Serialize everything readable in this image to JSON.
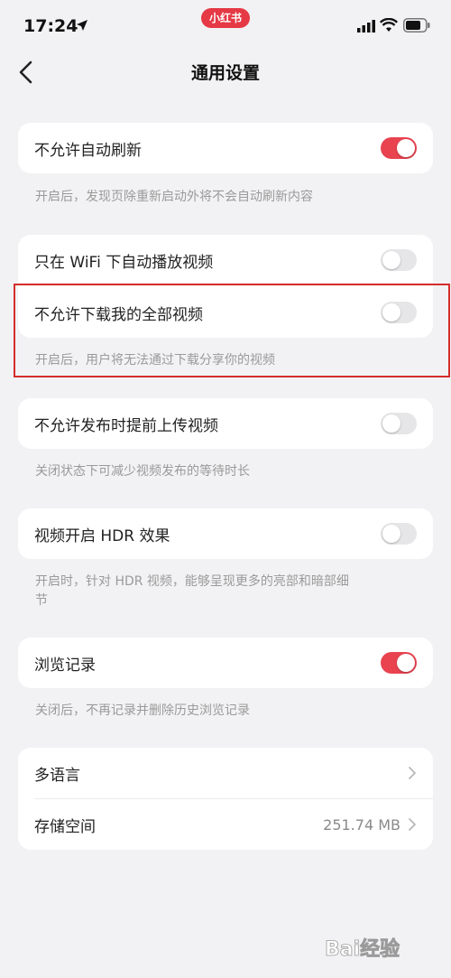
{
  "status_bar": {
    "time": "17:24",
    "app_badge": "小红书"
  },
  "nav": {
    "title": "通用设置"
  },
  "settings": {
    "auto_refresh": {
      "label": "不允许自动刷新",
      "enabled": true,
      "description": "开启后，发现页除重新启动外将不会自动刷新内容"
    },
    "wifi_autoplay": {
      "label": "只在 WiFi 下自动播放视频",
      "enabled": false
    },
    "no_download": {
      "label": "不允许下载我的全部视频",
      "enabled": false,
      "description": "开启后，用户将无法通过下载分享你的视频"
    },
    "preupload": {
      "label": "不允许发布时提前上传视频",
      "enabled": false,
      "description": "关闭状态下可减少视频发布的等待时长"
    },
    "hdr": {
      "label": "视频开启 HDR 效果",
      "enabled": false,
      "description_line1": "开启时，针对 HDR 视频，能够呈现更多的亮部和暗部细",
      "description_line2": "节"
    },
    "history": {
      "label": "浏览记录",
      "enabled": true,
      "description": "关闭后，不再记录并删除历史浏览记录"
    },
    "language": {
      "label": "多语言"
    },
    "storage": {
      "label": "存储空间",
      "value": "251.74 MB"
    }
  },
  "colors": {
    "accent": "#e94350",
    "toggle_off": "#e6e6e8",
    "highlight_border": "#d52c2c",
    "background": "#f2f2f4"
  },
  "watermark": {
    "text": "Bai经验"
  }
}
